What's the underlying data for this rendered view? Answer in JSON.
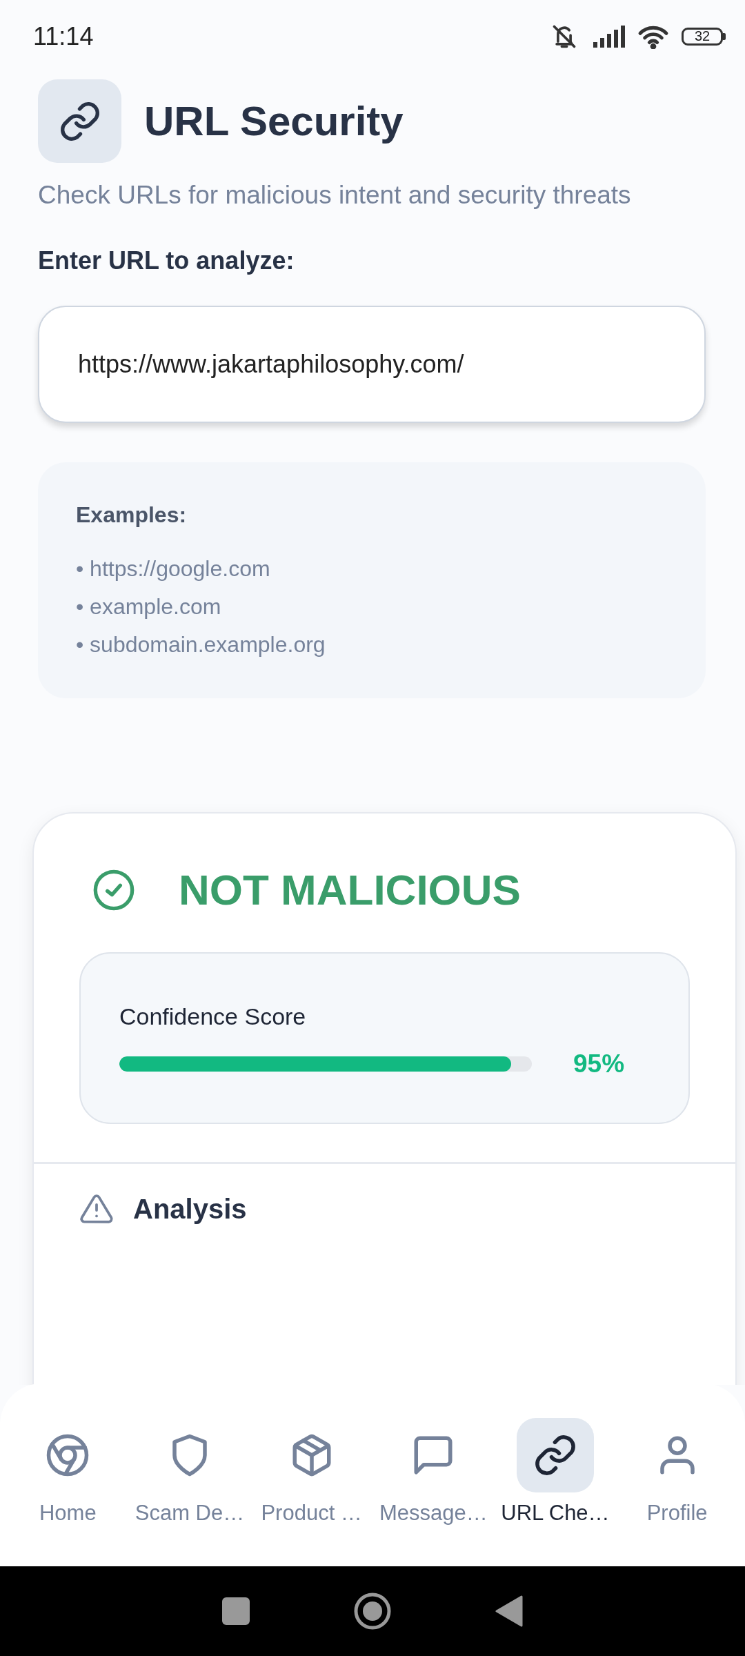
{
  "status_bar": {
    "time": "11:14",
    "battery": "32"
  },
  "header": {
    "title": "URL Security",
    "subtitle": "Check URLs for malicious intent and security threats"
  },
  "url_input": {
    "label": "Enter URL to analyze:",
    "value": "https://www.jakartaphilosophy.com/"
  },
  "examples": {
    "title": "Examples:",
    "items": [
      "• https://google.com",
      "• example.com",
      "• subdomain.example.org"
    ]
  },
  "result": {
    "verdict": "NOT MALICIOUS",
    "kind": "safe",
    "confidence": {
      "label": "Confidence Score",
      "level": 0.95,
      "reading": "95%"
    },
    "analysis": {
      "title": "Analysis"
    }
  },
  "nav": [
    {
      "label": "Home",
      "kind": "home",
      "selected": false
    },
    {
      "label": "Scam De…",
      "kind": "shield",
      "selected": false
    },
    {
      "label": "Product …",
      "kind": "box",
      "selected": false
    },
    {
      "label": "Message…",
      "kind": "message",
      "selected": false
    },
    {
      "label": "URL Che…",
      "kind": "link",
      "selected": true
    },
    {
      "label": "Profile",
      "kind": "profile",
      "selected": false
    }
  ]
}
